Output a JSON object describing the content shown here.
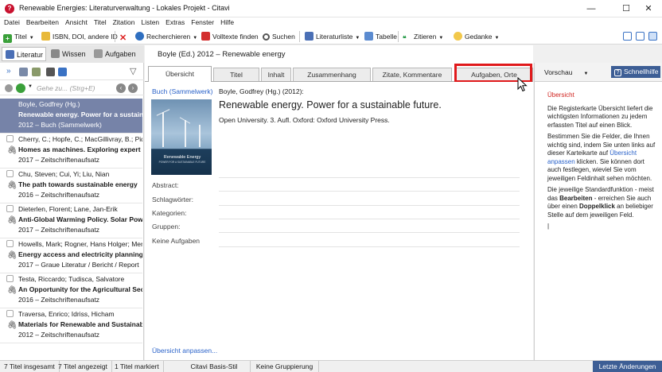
{
  "window": {
    "title": "Renewable Energies: Literaturverwaltung - Lokales Projekt - Citavi",
    "minimize": "—",
    "maximize": "☐",
    "close": "✕"
  },
  "menu": [
    "Datei",
    "Bearbeiten",
    "Ansicht",
    "Titel",
    "Zitation",
    "Listen",
    "Extras",
    "Fenster",
    "Hilfe"
  ],
  "toolbar": {
    "titel": "Titel",
    "isbn": "ISBN, DOI, andere ID",
    "recherchieren": "Recherchieren",
    "volltexte": "Volltexte finden",
    "suchen": "Suchen",
    "literaturliste": "Literaturliste",
    "tabelle": "Tabelle",
    "zitieren": "Zitieren",
    "gedanke": "Gedanke"
  },
  "nav": {
    "literatur": "Literatur",
    "wissen": "Wissen",
    "aufgaben": "Aufgaben"
  },
  "search": {
    "placeholder": "Gehe zu... (Strg+E)"
  },
  "references": [
    {
      "authors": "Boyle, Godfrey (Hg.)",
      "title": "Renewable energy. Power for a sustainabl",
      "meta": "2012 – Buch (Sammelwerk)"
    },
    {
      "authors": "Cherry, C.; Hopfe, C.; MacGillivray, B.; Pidge",
      "title": "Homes as machines. Exploring expert and",
      "meta": "2017 – Zeitschriftenaufsatz"
    },
    {
      "authors": "Chu, Steven; Cui, Yi; Liu, Nian",
      "title": "The path towards sustainable energy",
      "meta": "2016 – Zeitschriftenaufsatz"
    },
    {
      "authors": "Dieterlen, Florent; Lane, Jan-Erik",
      "title": "Anti-Global Warming Policy. Solar Power P",
      "meta": "2017 – Zeitschriftenaufsatz"
    },
    {
      "authors": "Howells, Mark; Rogner, Hans Holger; Menti",
      "title": "Energy access and electricity planning",
      "meta": "2017 – Graue Literatur / Bericht / Report"
    },
    {
      "authors": "Testa, Riccardo; Tudisca, Salvatore",
      "title": "An Opportunity for the Agricultural Secto",
      "meta": "2016 – Zeitschriftenaufsatz"
    },
    {
      "authors": "Traversa, Enrico; Idriss, Hicham",
      "title": "Materials for Renewable and Sustainable",
      "meta": "2012 – Zeitschriftenaufsatz"
    }
  ],
  "main": {
    "header": "Boyle (Ed.) 2012 – Renewable energy",
    "tabs": [
      "Übersicht",
      "Titel",
      "Inhalt",
      "Zusammenhang",
      "Zitate, Kommentare",
      "Aufgaben, Orte"
    ],
    "type_link": "Buch (Sammelwerk)",
    "citation_line": "Boyle, Godfrey (Hg.) (2012):",
    "big_title": "Renewable energy. Power for a sustainable future.",
    "publisher": "Open University. 3. Aufl. Oxford: Oxford University Press.",
    "cover_title": "Renewable Energy",
    "cover_sub": "POWER FOR A SUSTAINABLE FUTURE",
    "fields": [
      "Abstract:",
      "Schlagwörter:",
      "Kategorien:",
      "Gruppen:",
      "Keine Aufgaben"
    ],
    "customize_link": "Übersicht anpassen..."
  },
  "preview": {
    "label": "Vorschau",
    "help": "Schnellhilfe",
    "heading": "Übersicht",
    "p1": "Die Registerkarte Übersicht liefert die wichtigsten Informationen zu jedem erfassten Titel auf einen Blick.",
    "p2a": "Bestimmen Sie die Felder, die Ihnen wichtig sind, indem Sie unten links auf dieser Karteikarte auf ",
    "p2link": "Übersicht anpassen",
    "p2b": " klicken. Sie können dort auch festlegen, wieviel Sie vom jeweiligen Feldinhalt sehen möchten.",
    "p3a": "Die jeweilige Standardfunktion - meist das ",
    "p3b1": "Bearbeiten",
    "p3c": " - erreichen Sie auch über einen ",
    "p3b2": "Doppelklick",
    "p3d": " an beliebiger Stelle auf dem jeweiligen Feld."
  },
  "status": {
    "total": "7 Titel insgesamt",
    "shown": "7 Titel angezeigt",
    "marked": "1 Titel markiert",
    "style": "Citavi Basis-Stil",
    "grouping": "Keine Gruppierung",
    "changes": "Letzte Änderungen"
  },
  "colors": {
    "accent": "#7683a8",
    "highlight": "#e0191b",
    "link": "#2a62c9",
    "help_button": "#3d5e95"
  }
}
